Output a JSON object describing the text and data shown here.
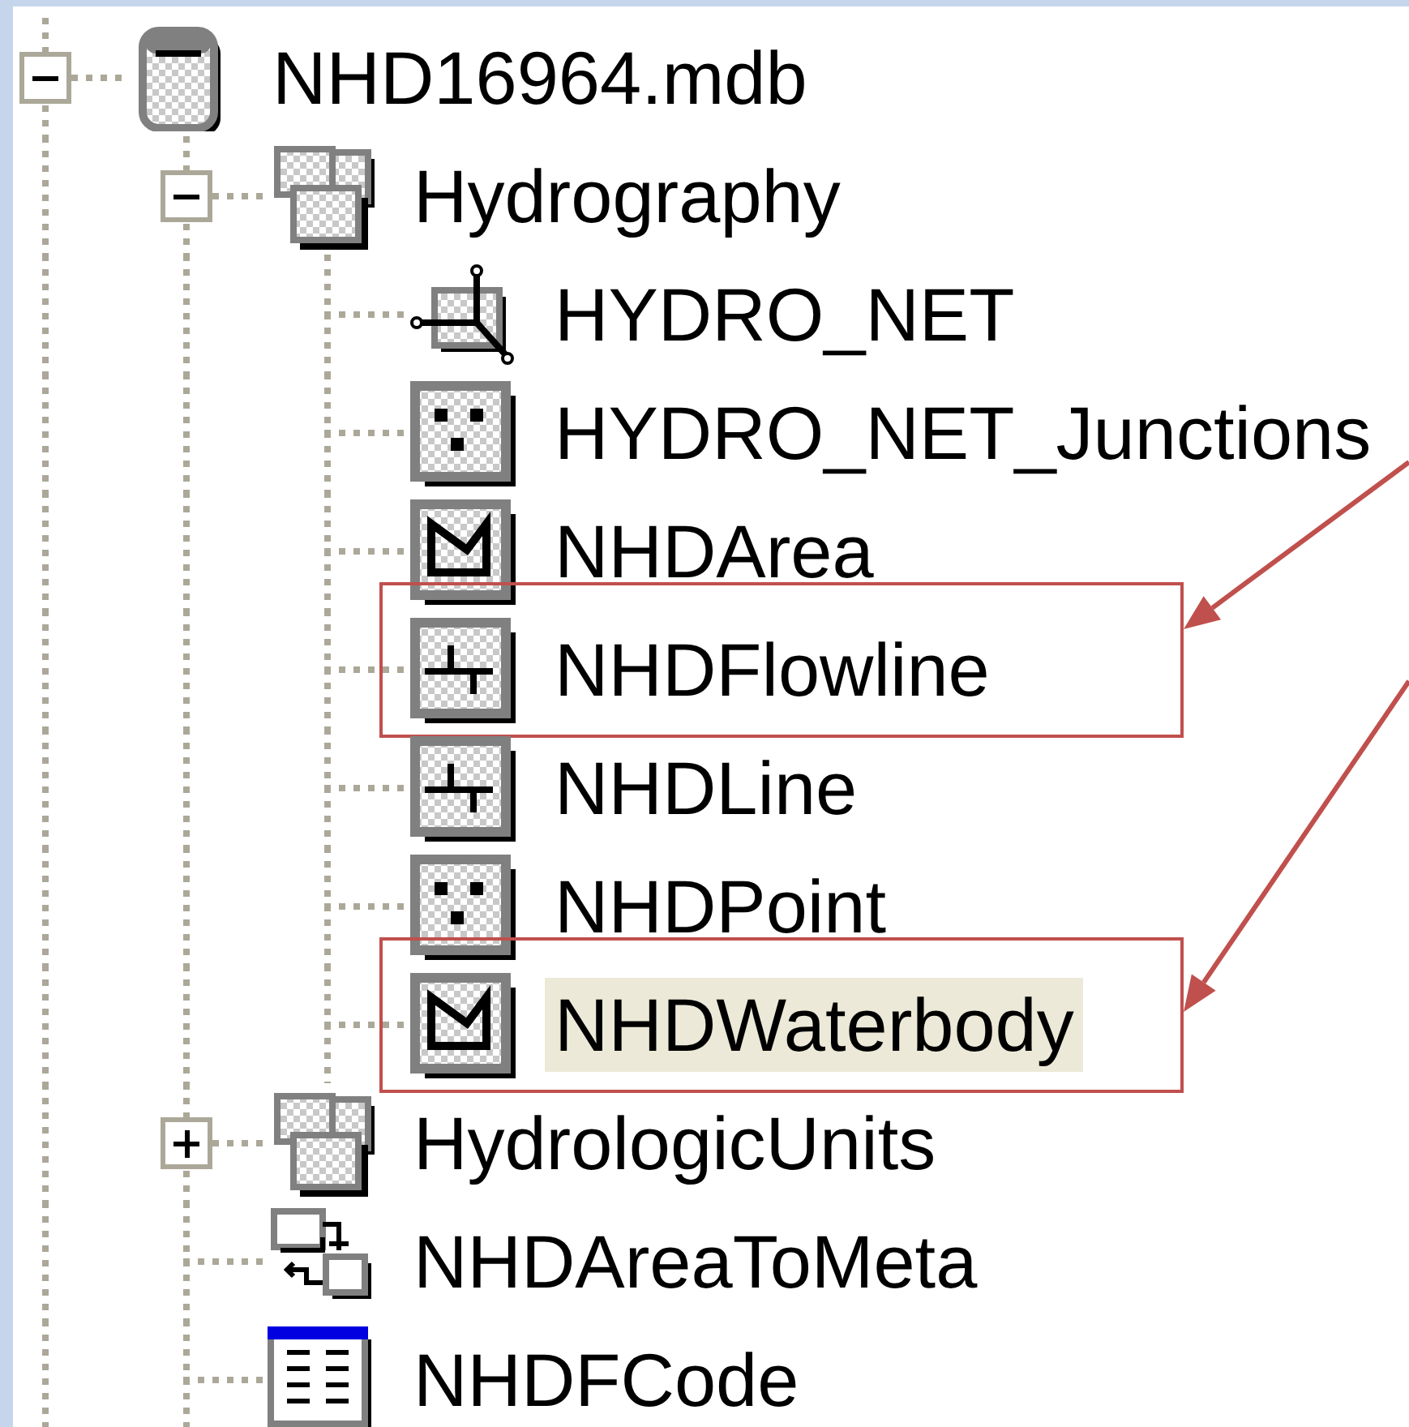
{
  "tree": {
    "items": [
      {
        "label": "NHD16964.mdb",
        "kind": "database",
        "expanded": true,
        "selected": false,
        "children": [
          {
            "label": "Hydrography",
            "kind": "feature-dataset",
            "expanded": true,
            "selected": false,
            "children": [
              {
                "label": "HYDRO_NET",
                "kind": "network",
                "selected": false
              },
              {
                "label": "HYDRO_NET_Junctions",
                "kind": "points",
                "selected": false
              },
              {
                "label": "NHDArea",
                "kind": "polygons",
                "selected": false
              },
              {
                "label": "NHDFlowline",
                "kind": "lines",
                "selected": false,
                "callout": true
              },
              {
                "label": "NHDLine",
                "kind": "lines",
                "selected": false
              },
              {
                "label": "NHDPoint",
                "kind": "points",
                "selected": false
              },
              {
                "label": "NHDWaterbody",
                "kind": "polygons",
                "selected": true,
                "callout": true
              }
            ]
          },
          {
            "label": "HydrologicUnits",
            "kind": "feature-dataset",
            "expanded": false,
            "selected": false
          },
          {
            "label": "NHDAreaToMeta",
            "kind": "relationship",
            "selected": false
          },
          {
            "label": "NHDFCode",
            "kind": "table",
            "selected": false
          }
        ]
      }
    ]
  }
}
